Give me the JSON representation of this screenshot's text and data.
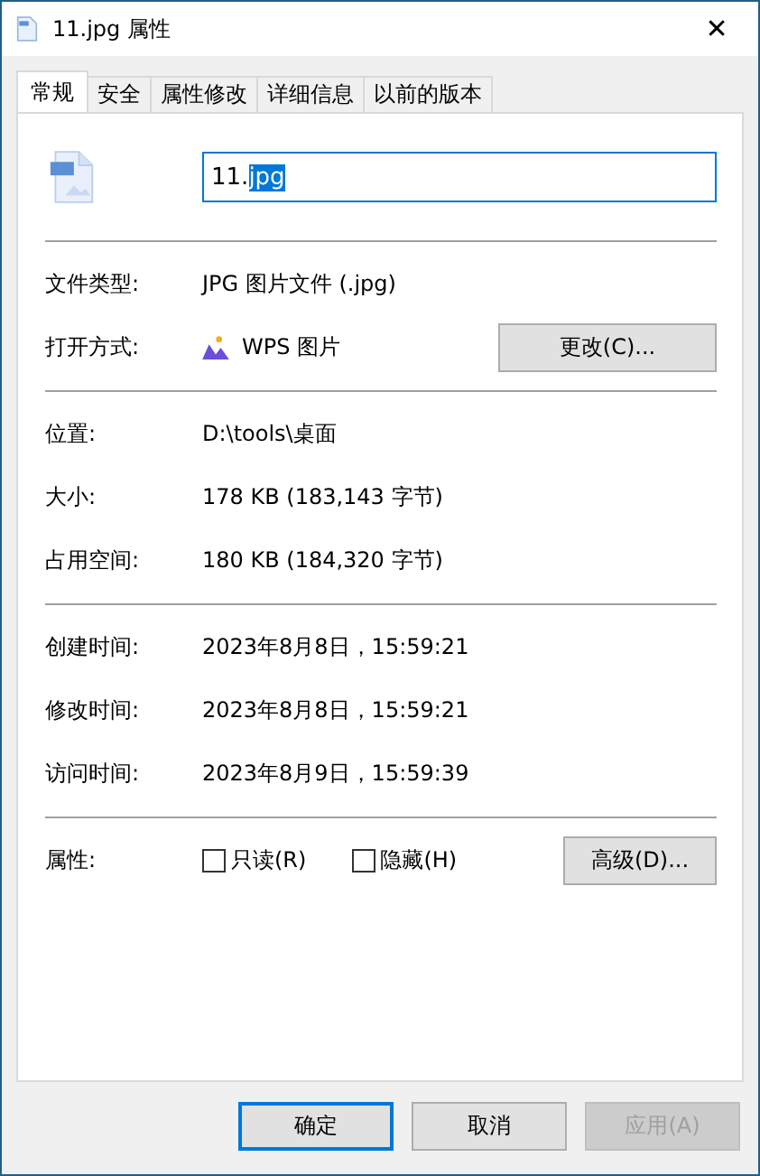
{
  "window": {
    "title": "11.jpg 属性",
    "close": "✕"
  },
  "tabs": [
    {
      "label": "常规",
      "selected": true
    },
    {
      "label": "安全",
      "selected": false
    },
    {
      "label": "属性修改",
      "selected": false
    },
    {
      "label": "详细信息",
      "selected": false
    },
    {
      "label": "以前的版本",
      "selected": false
    }
  ],
  "name_field": {
    "text_before": "11.",
    "selected_text": "jpg"
  },
  "sections": [
    [
      {
        "kind": "text",
        "label": "文件类型:",
        "value": "JPG 图片文件 (.jpg)"
      },
      {
        "kind": "app",
        "label": "打开方式:",
        "value": "WPS 图片",
        "button": "更改(C)..."
      }
    ],
    [
      {
        "kind": "text",
        "label": "位置:",
        "value": "D:\\tools\\桌面"
      },
      {
        "kind": "text",
        "label": "大小:",
        "value": "178 KB (183,143 字节)"
      },
      {
        "kind": "text",
        "label": "占用空间:",
        "value": "180 KB (184,320 字节)"
      }
    ],
    [
      {
        "kind": "text",
        "label": "创建时间:",
        "value": "2023年8月8日，15:59:21"
      },
      {
        "kind": "text",
        "label": "修改时间:",
        "value": "2023年8月8日，15:59:21"
      },
      {
        "kind": "text",
        "label": "访问时间:",
        "value": "2023年8月9日，15:59:39"
      }
    ],
    [
      {
        "kind": "attributes",
        "label": "属性:",
        "checkboxes": [
          {
            "label": "只读(R)",
            "checked": false
          },
          {
            "label": "隐藏(H)",
            "checked": false
          }
        ],
        "button": "高级(D)..."
      }
    ]
  ],
  "buttons": [
    {
      "label": "确定",
      "default": true,
      "disabled": false
    },
    {
      "label": "取消",
      "default": false,
      "disabled": false
    },
    {
      "label": "应用(A)",
      "default": false,
      "disabled": true
    }
  ]
}
